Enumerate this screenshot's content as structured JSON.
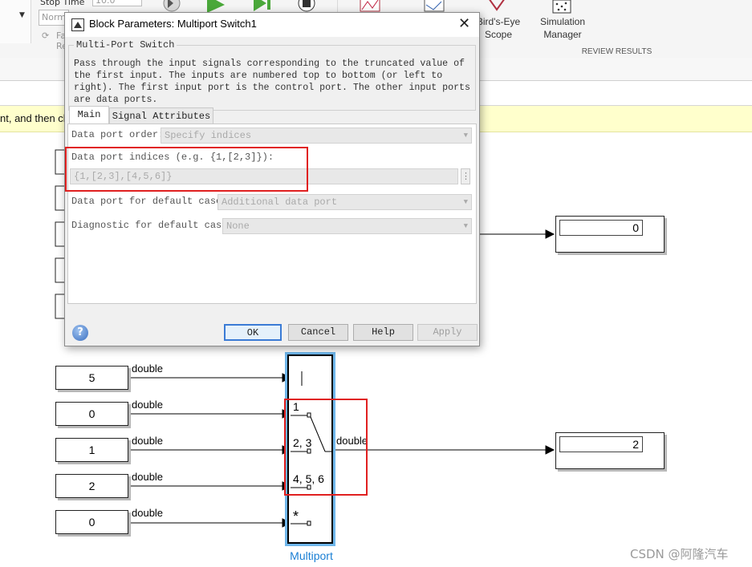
{
  "toolstrip": {
    "stop_time_label": "Stop Time",
    "stop_time_value": "10.0",
    "mode_value": "Normal",
    "fast_restart_label": "Fast Restart",
    "birds_eye_label_1": "Bird's-Eye",
    "birds_eye_label_2": "Scope",
    "sim_manager_label_1": "Simulation",
    "sim_manager_label_2": "Manager",
    "review_results": "REVIEW RESULTS"
  },
  "banner": {
    "text": "nt, and then cl"
  },
  "canvas": {
    "constants": [
      {
        "value": "5",
        "signal": "double"
      },
      {
        "value": "0",
        "signal": "double"
      },
      {
        "value": "1",
        "signal": "double"
      },
      {
        "value": "2",
        "signal": "double"
      },
      {
        "value": "0",
        "signal": "double"
      }
    ],
    "top_display_value": "0",
    "bottom_display_value": "2",
    "output_signal": "double",
    "switch_port_labels": [
      "1",
      "2, 3",
      "4, 5, 6",
      "*"
    ],
    "block_name": "Multiport"
  },
  "dialog": {
    "title": "Block Parameters: Multiport Switch1",
    "close": "✕",
    "group_title": "Multi-Port Switch",
    "description": "Pass through the input signals corresponding to the truncated value of the first input. The inputs are numbered top to bottom (or left to right). The first input port is the control port. The other input ports are data ports.",
    "tabs": [
      "Main",
      "Signal Attributes"
    ],
    "params": {
      "data_port_order_label": "Data port order:",
      "data_port_order_value": "Specify indices",
      "indices_label": "Data port indices (e.g. {1,[2,3]}):",
      "indices_value": "{1,[2,3],[4,5,6]}",
      "default_case_label": "Data port for default case:",
      "default_case_value": "Additional data port",
      "diagnostic_label": "Diagnostic for default case:",
      "diagnostic_value": "None"
    },
    "buttons": {
      "ok": "OK",
      "cancel": "Cancel",
      "help": "Help",
      "apply": "Apply"
    },
    "help_icon": "?"
  },
  "watermark": "CSDN @阿隆汽车",
  "colors": {
    "highlight_red": "#e02020",
    "selection_blue": "#6fb6ea",
    "banner": "#ffffcc"
  },
  "icons": [
    "step-back-icon",
    "play-icon",
    "step-forward-icon",
    "stop-icon",
    "birds-eye-scope-icon",
    "simulation-manager-icon",
    "help-icon"
  ]
}
